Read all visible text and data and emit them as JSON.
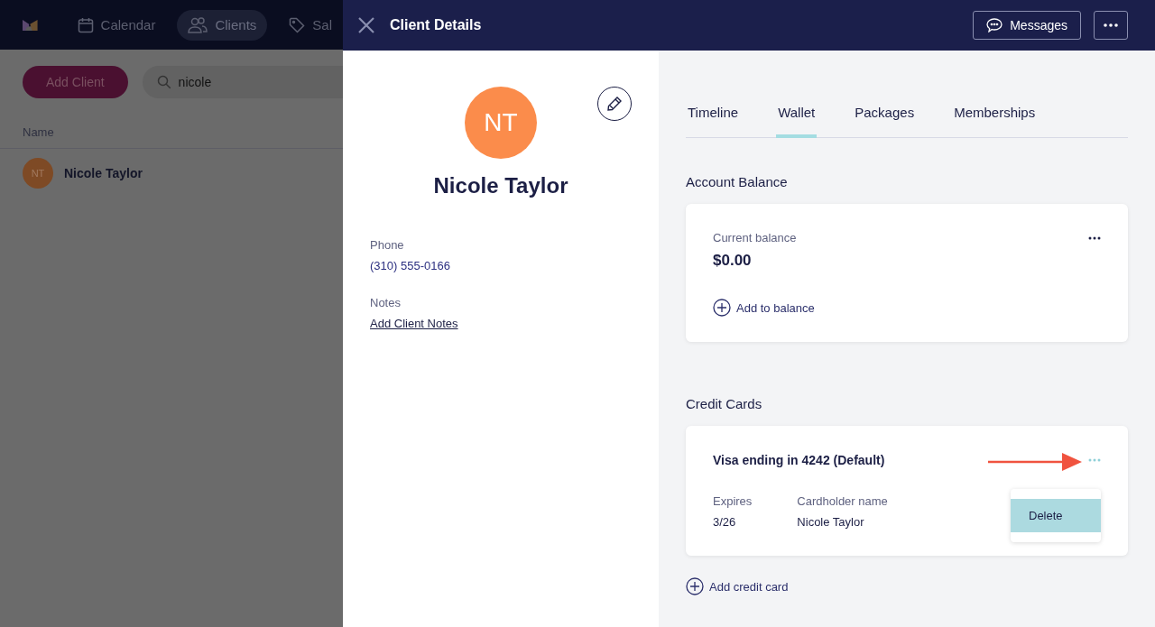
{
  "background_app": {
    "nav": [
      {
        "label": "Calendar",
        "kind": "calendar",
        "selected": false
      },
      {
        "label": "Clients",
        "kind": "people",
        "selected": true
      },
      {
        "label": "Sal",
        "kind": "tag",
        "selected": false
      }
    ],
    "add_button": "Add Client",
    "search": {
      "value": "nicole"
    },
    "table": {
      "columns": [
        "Name"
      ],
      "rows": [
        {
          "initials": "NT",
          "name": "Nicole Taylor"
        }
      ]
    }
  },
  "panel": {
    "title": "Client Details",
    "messages_button": "Messages",
    "client": {
      "initials": "NT",
      "name": "Nicole Taylor",
      "fields": [
        {
          "label": "Phone",
          "value": "(310) 555-0166",
          "kind": "text"
        },
        {
          "label": "Notes",
          "value": "Add Client Notes",
          "kind": "link"
        }
      ]
    },
    "tabs": [
      {
        "label": "Timeline",
        "selected": false
      },
      {
        "label": "Wallet",
        "selected": true
      },
      {
        "label": "Packages",
        "selected": false
      },
      {
        "label": "Memberships",
        "selected": false
      }
    ],
    "account_balance": {
      "heading": "Account Balance",
      "label": "Current balance",
      "amount": "$0.00",
      "action": "Add to balance"
    },
    "credit_cards": {
      "heading": "Credit Cards",
      "cards": [
        {
          "title": "Visa ending in 4242 (Default)",
          "fields": [
            {
              "label": "Expires",
              "value": "3/26"
            },
            {
              "label": "Cardholder name",
              "value": "Nicole Taylor"
            }
          ],
          "menu": [
            "Delete"
          ]
        }
      ],
      "action": "Add credit card"
    }
  }
}
